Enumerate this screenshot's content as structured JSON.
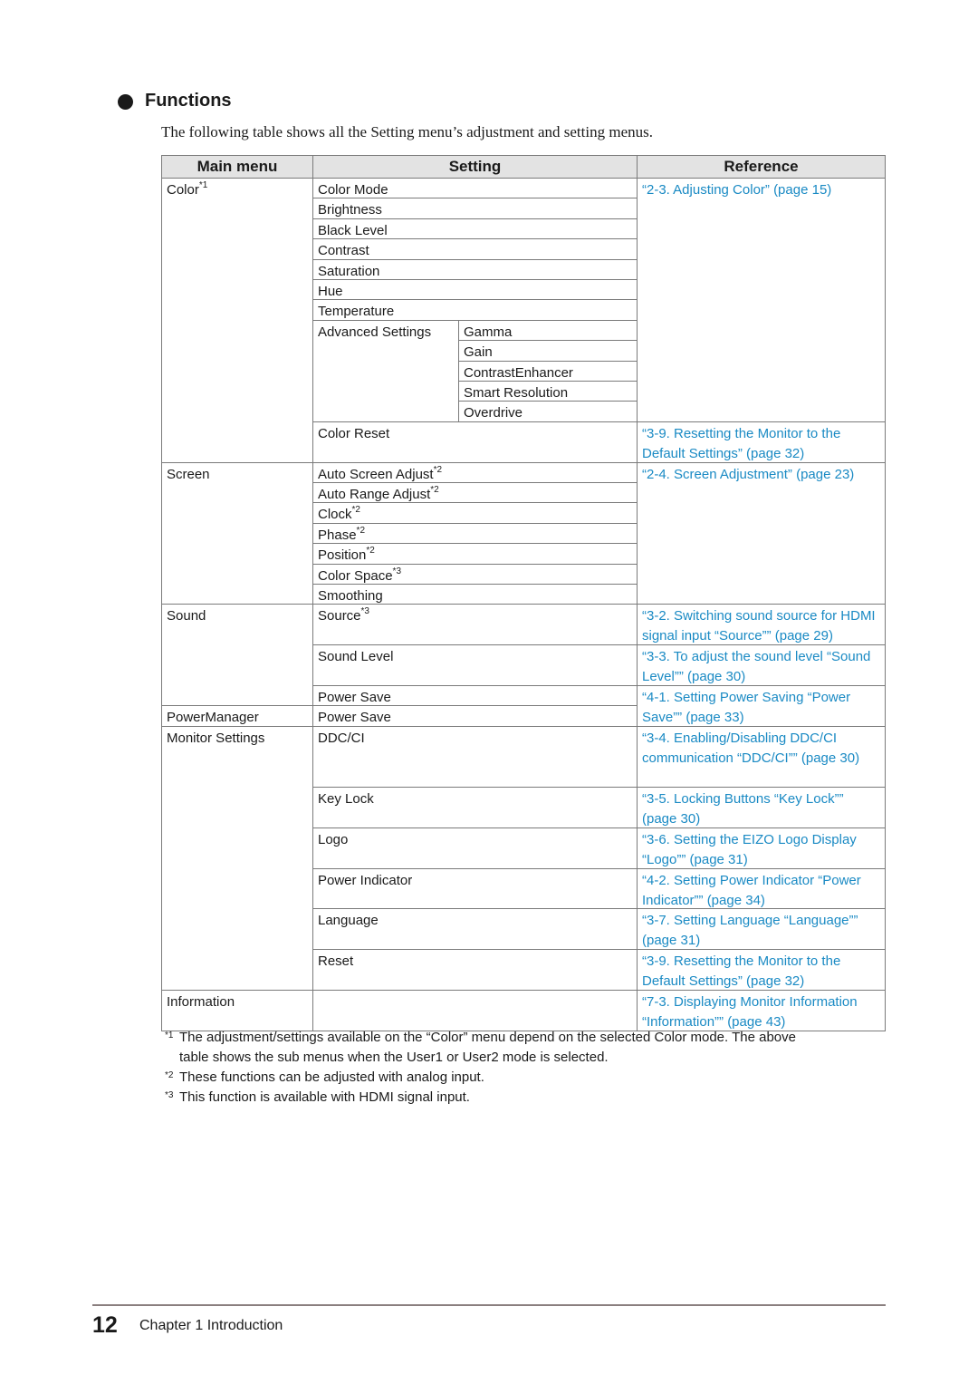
{
  "section": {
    "bullet_icon": "filled-circle",
    "title": "Functions",
    "intro": "The following table shows all the Setting menu’s adjustment and setting menus."
  },
  "table": {
    "headers": [
      "Main menu",
      "Setting",
      "Reference"
    ],
    "main_menus": [
      {
        "label": "Color",
        "sup": "*1"
      },
      {
        "label": "Screen",
        "sup": ""
      },
      {
        "label": "Sound",
        "sup": ""
      },
      {
        "label": "PowerManager",
        "sup": ""
      },
      {
        "label": "Monitor Settings",
        "sup": ""
      },
      {
        "label": "Information",
        "sup": ""
      }
    ],
    "settings": [
      {
        "label": "Color Mode",
        "sup": ""
      },
      {
        "label": "Brightness",
        "sup": ""
      },
      {
        "label": "Black Level",
        "sup": ""
      },
      {
        "label": "Contrast",
        "sup": ""
      },
      {
        "label": "Saturation",
        "sup": ""
      },
      {
        "label": "Hue",
        "sup": ""
      },
      {
        "label": "Temperature",
        "sup": ""
      },
      {
        "label": "Advanced Settings",
        "sup": ""
      },
      {
        "label": "Color Reset",
        "sup": ""
      },
      {
        "label": "Auto Screen Adjust",
        "sup": "*2"
      },
      {
        "label": "Auto Range Adjust",
        "sup": "*2"
      },
      {
        "label": "Clock",
        "sup": "*2"
      },
      {
        "label": "Phase",
        "sup": "*2"
      },
      {
        "label": "Position",
        "sup": "*2"
      },
      {
        "label": "Color Space",
        "sup": "*3"
      },
      {
        "label": "Smoothing",
        "sup": ""
      },
      {
        "label": "Source",
        "sup": "*3"
      },
      {
        "label": "Sound Level",
        "sup": ""
      },
      {
        "label": "Power Save",
        "sup": ""
      },
      {
        "label": "Power Save",
        "sup": ""
      },
      {
        "label": "DDC/CI",
        "sup": ""
      },
      {
        "label": "Key Lock",
        "sup": ""
      },
      {
        "label": "Logo",
        "sup": ""
      },
      {
        "label": "Power Indicator",
        "sup": ""
      },
      {
        "label": "Language",
        "sup": ""
      },
      {
        "label": "Reset",
        "sup": ""
      },
      {
        "label": "",
        "sup": ""
      }
    ],
    "advanced_sub": [
      "Gamma",
      "Gain",
      "ContrastEnhancer",
      "Smart Resolution",
      "Overdrive"
    ],
    "references": [
      "“2-3. Adjusting Color” (page 15)",
      "“3-9. Resetting the Monitor to the Default Settings” (page 32)",
      "“2-4. Screen Adjustment” (page 23)",
      "“3-2. Switching sound source for HDMI signal input “Source”” (page 29)",
      "“3-3. To adjust the sound level “Sound Level”” (page 30)",
      "“4-1. Setting Power Saving “Power Save”” (page 33)",
      "“3-4. Enabling/Disabling DDC/CI communication “DDC/CI”” (page 30)",
      "“3-5. Locking Buttons “Key Lock”” (page 30)",
      "“3-6. Setting the EIZO Logo Display “Logo”” (page 31)",
      "“4-2. Setting Power Indicator “Power Indicator”” (page 34)",
      "“3-7. Setting Language “Language”” (page 31)",
      "“3-9. Resetting the Monitor to the Default Settings” (page 32)",
      "“7-3. Displaying Monitor Information “Information”” (page 43)"
    ]
  },
  "notes": [
    {
      "mark": "*1",
      "text": "The adjustment/settings available on the “Color” menu depend on the selected Color mode. The above",
      "cont": "table shows the sub menus when the User1 or User2 mode is selected."
    },
    {
      "mark": "*2",
      "text": "These functions can be adjusted with analog input.",
      "cont": ""
    },
    {
      "mark": "*3",
      "text": "This function is available with HDMI signal input.",
      "cont": ""
    }
  ],
  "footer": {
    "page_number": "12",
    "chapter": "Chapter 1 Introduction"
  }
}
